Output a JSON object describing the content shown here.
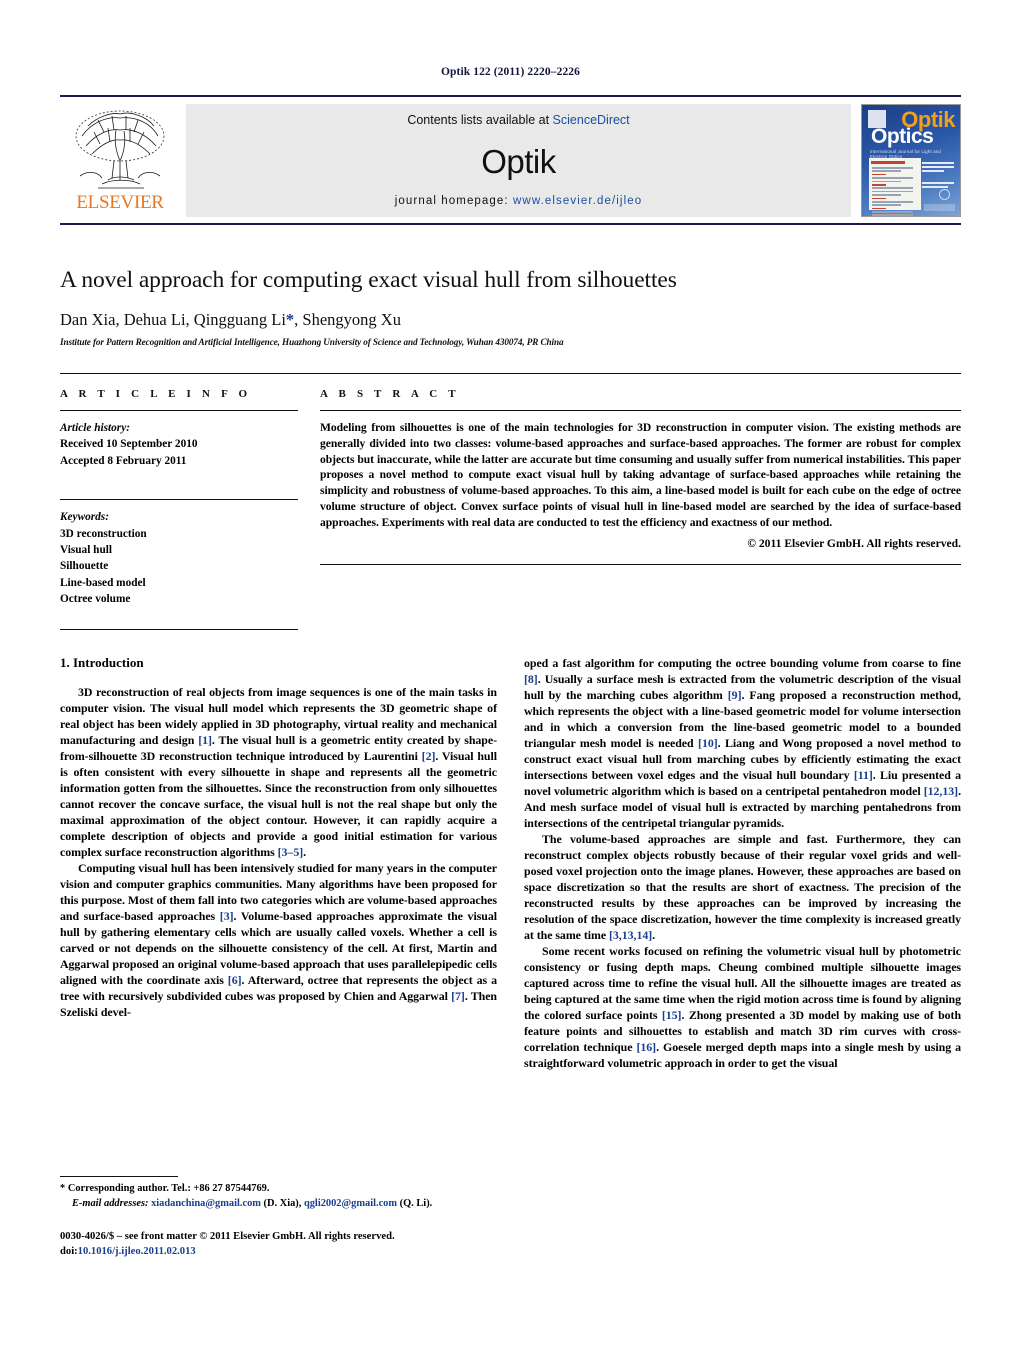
{
  "running_head": "Optik 122 (2011) 2220–2226",
  "masthead": {
    "publisher_logo_text": "ELSEVIER",
    "contents_prefix": "Contents lists available at ",
    "contents_link": "ScienceDirect",
    "journal_name": "Optik",
    "homepage_label": "journal homepage: ",
    "homepage_url": "www.elsevier.de/ijleo",
    "cover": {
      "title_top": "Optik",
      "title_bottom": "Optics",
      "subtitle": "International Journal for Light and Electron Optics"
    }
  },
  "article": {
    "title": "A novel approach for computing exact visual hull from silhouettes",
    "authors": "Dan Xia, Dehua Li, Qingguang Li",
    "authors_star": "*",
    "authors_tail": ", Shengyong Xu",
    "affiliation": "Institute for Pattern Recognition and Artificial Intelligence, Huazhong University of Science and Technology, Wuhan 430074, PR China"
  },
  "info": {
    "heading": "A R T I C L E   I N F O",
    "history_label": "Article history:",
    "history": [
      "Received 10 September 2010",
      "Accepted 8 February 2011"
    ],
    "keywords_label": "Keywords:",
    "keywords": [
      "3D reconstruction",
      "Visual hull",
      "Silhouette",
      "Line-based model",
      "Octree volume"
    ]
  },
  "abstract": {
    "heading": "A B S T R A C T",
    "text": "Modeling from silhouettes is one of the main technologies for 3D reconstruction in computer vision. The existing methods are generally divided into two classes: volume-based approaches and surface-based approaches. The former are robust for complex objects but inaccurate, while the latter are accurate but time consuming and usually suffer from numerical instabilities. This paper proposes a novel method to compute exact visual hull by taking advantage of surface-based approaches while retaining the simplicity and robustness of volume-based approaches. To this aim, a line-based model is built for each cube on the edge of octree volume structure of object. Convex surface points of visual hull in line-based model are searched by the idea of surface-based approaches. Experiments with real data are conducted to test the efficiency and exactness of our method.",
    "copyright": "© 2011 Elsevier GmbH. All rights reserved."
  },
  "body": {
    "section_number_title": "1.  Introduction",
    "left_paragraphs": [
      "3D reconstruction of real objects from image sequences is one of the main tasks in computer vision. The visual hull model which represents the 3D geometric shape of real object has been widely applied in 3D photography, virtual reality and mechanical manufacturing and design [1]. The visual hull is a geometric entity created by shape-from-silhouette 3D reconstruction technique introduced by Laurentini [2]. Visual hull is often consistent with every silhouette in shape and represents all the geometric information gotten from the silhouettes. Since the reconstruction from only silhouettes cannot recover the concave surface, the visual hull is not the real shape but only the maximal approximation of the object contour. However, it can rapidly acquire a complete description of objects and provide a good initial estimation for various complex surface reconstruction algorithms [3–5].",
      "Computing visual hull has been intensively studied for many years in the computer vision and computer graphics communities. Many algorithms have been proposed for this purpose. Most of them fall into two categories which are volume-based approaches and surface-based approaches [3]. Volume-based approaches approximate the visual hull by gathering elementary cells which are usually called voxels. Whether a cell is carved or not depends on the silhouette consistency of the cell. At first, Martin and Aggarwal proposed an original volume-based approach that uses parallelepipedic cells aligned with the coordinate axis [6]. Afterward, octree that represents the object as a tree with recursively subdivided cubes was proposed by Chien and Aggarwal [7]. Then Szeliski devel-"
    ],
    "right_paragraphs": [
      "oped a fast algorithm for computing the octree bounding volume from coarse to fine [8]. Usually a surface mesh is extracted from the volumetric description of the visual hull by the marching cubes algorithm [9]. Fang proposed a reconstruction method, which represents the object with a line-based geometric model for volume intersection and in which a conversion from the line-based geometric model to a bounded triangular mesh model is needed [10]. Liang and Wong proposed a novel method to construct exact visual hull from marching cubes by efficiently estimating the exact intersections between voxel edges and the visual hull boundary [11]. Liu presented a novel volumetric algorithm which is based on a centripetal pentahedron model [12,13]. And mesh surface model of visual hull is extracted by marching pentahedrons from intersections of the centripetal triangular pyramids.",
      "The volume-based approaches are simple and fast. Furthermore, they can reconstruct complex objects robustly because of their regular voxel grids and well-posed voxel projection onto the image planes. However, these approaches are based on space discretization so that the results are short of exactness. The precision of the reconstructed results by these approaches can be improved by increasing the resolution of the space discretization, however the time complexity is increased greatly at the same time [3,13,14].",
      "Some recent works focused on refining the volumetric visual hull by photometric consistency or fusing depth maps. Cheung combined multiple silhouette images captured across time to refine the visual hull. All the silhouette images are treated as being captured at the same time when the rigid motion across time is found by aligning the colored surface points [15]. Zhong presented a 3D model by making use of both feature points and silhouettes to establish and match 3D rim curves with cross-correlation technique [16]. Goesele merged depth maps into a single mesh by using a straightforward volumetric approach in order to get the visual"
    ]
  },
  "footnote": {
    "star": "*",
    "corresponding": "Corresponding author. Tel.: +86 27 87544769.",
    "email_label": "E-mail addresses:",
    "email1": "xiadanchina@gmail.com",
    "email1_owner": "(D. Xia),",
    "email2": "qgli2002@gmail.com",
    "email2_owner": "(Q. Li)."
  },
  "imprint": {
    "issn_line": "0030-4026/$ – see front matter © 2011 Elsevier GmbH. All rights reserved.",
    "doi_prefix": "doi:",
    "doi": "10.1016/j.ijleo.2011.02.013"
  },
  "colors": {
    "link": "#1a3f8f",
    "elsevier_orange": "#e87722",
    "banner_gray": "#e9e9e9",
    "rule_navy": "#1b1b4f"
  }
}
